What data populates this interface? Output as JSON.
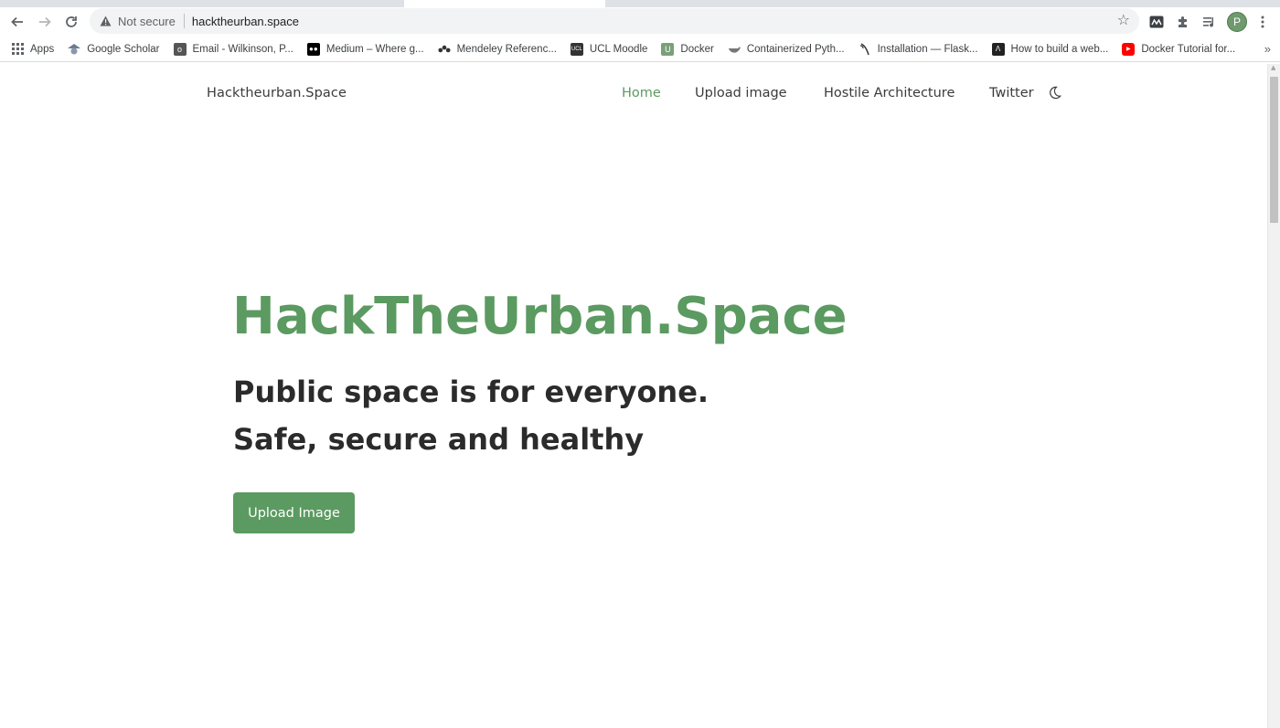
{
  "browser": {
    "security_label": "Not secure",
    "url": "hacktheurban.space",
    "avatar_letter": "P",
    "bookmarks": [
      {
        "label": "Apps",
        "icon": "apps-grid-icon",
        "color": "#5f6368"
      },
      {
        "label": "Google Scholar",
        "icon": "google-scholar-icon",
        "color": "#6b7a8f"
      },
      {
        "label": "Email - Wilkinson, P...",
        "icon": "outlook-icon",
        "color": "#555555"
      },
      {
        "label": "Medium – Where g...",
        "icon": "medium-icon",
        "color": "#000000"
      },
      {
        "label": "Mendeley Referenc...",
        "icon": "mendeley-icon",
        "color": "#333333"
      },
      {
        "label": "UCL Moodle",
        "icon": "ucl-icon",
        "color": "#333333"
      },
      {
        "label": "Docker",
        "icon": "docker-icon",
        "color": "#7aa07a"
      },
      {
        "label": "Containerized Pyth...",
        "icon": "whale-icon",
        "color": "#666666"
      },
      {
        "label": "Installation — Flask...",
        "icon": "flask-icon",
        "color": "#444444"
      },
      {
        "label": "How to build a web...",
        "icon": "web-icon",
        "color": "#222222"
      },
      {
        "label": "Docker Tutorial for...",
        "icon": "youtube-icon",
        "color": "#ff0000"
      }
    ],
    "more_bookmarks": "»"
  },
  "site": {
    "brand": "Hacktheurban.Space",
    "nav": {
      "home": "Home",
      "upload": "Upload image",
      "hostile": "Hostile Architecture",
      "twitter": "Twitter"
    },
    "hero": {
      "title": "HackTheUrban.Space",
      "subtitle_line1": "Public space is for everyone.",
      "subtitle_line2": "Safe, secure and healthy",
      "button": "Upload Image"
    },
    "accent_color": "#5b9a60"
  }
}
